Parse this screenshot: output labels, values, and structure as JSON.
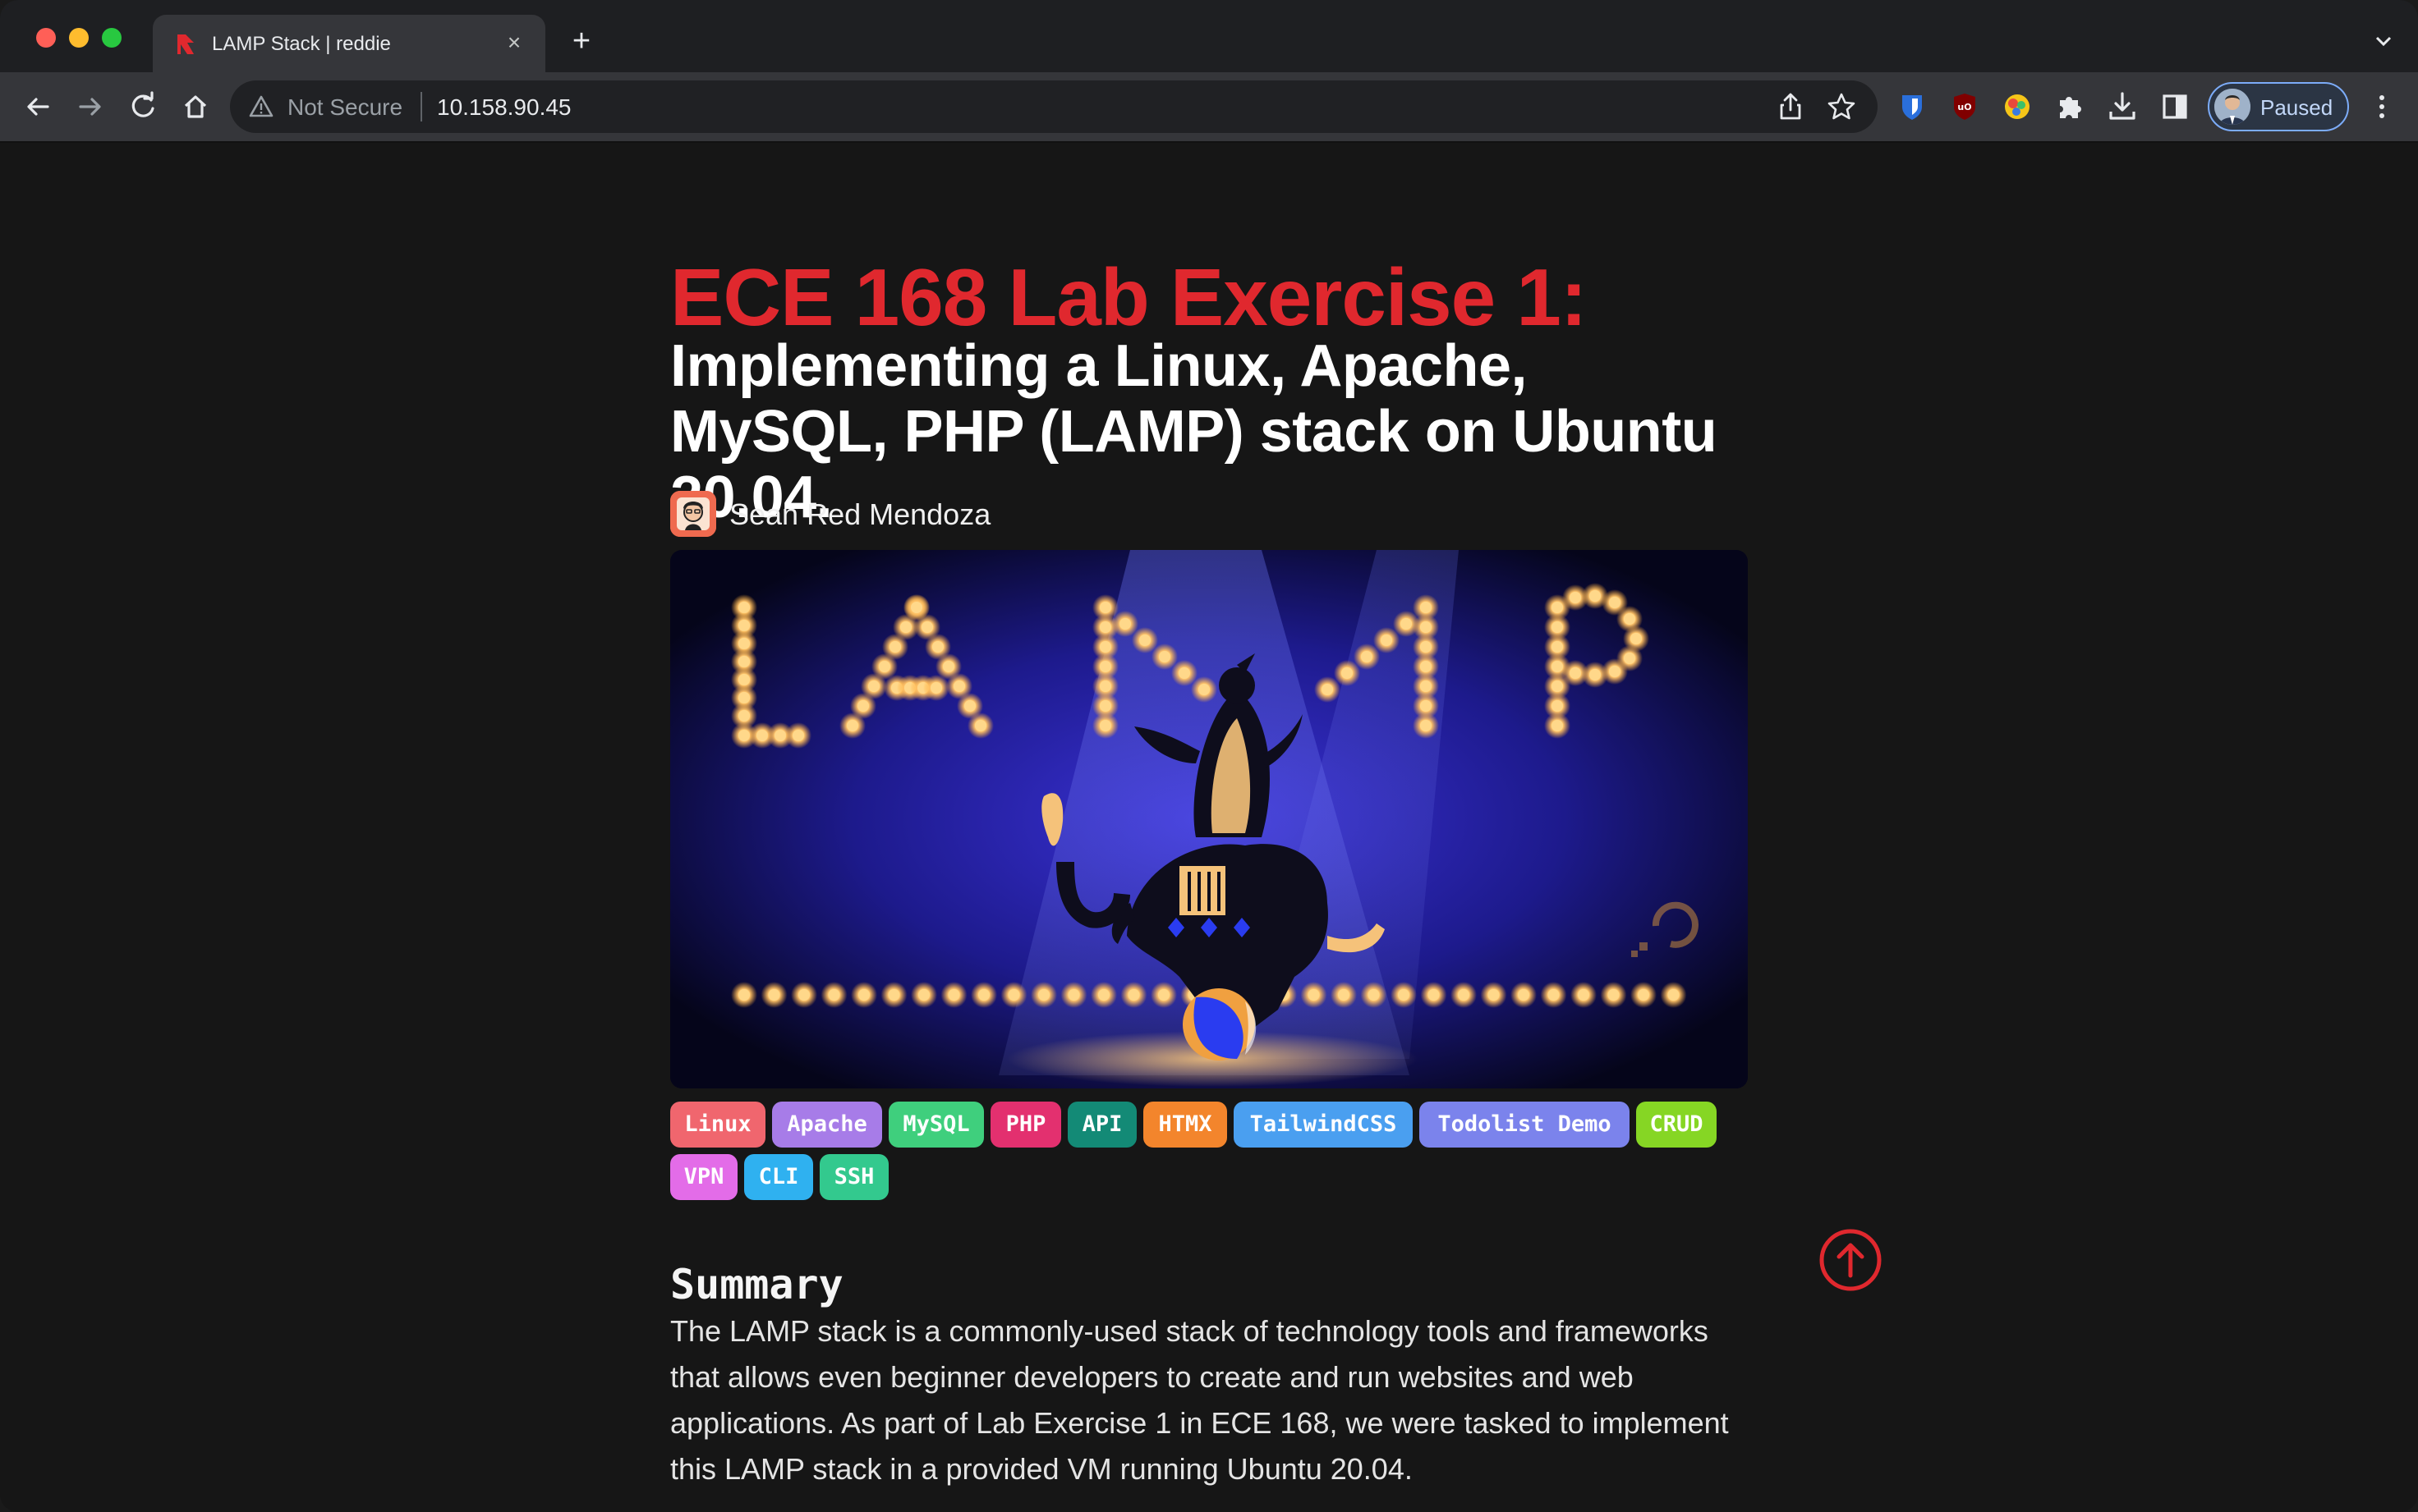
{
  "browser": {
    "tab": {
      "title": "LAMP Stack | reddie",
      "favicon": "reddie-logo-icon"
    },
    "address": {
      "security_label": "Not Secure",
      "url": "10.158.90.45"
    },
    "profile": {
      "label": "Paused"
    },
    "colors": {
      "tabstrip": "#1e1f22",
      "toolbar": "#35363a",
      "omnibox": "#202124"
    }
  },
  "article": {
    "title": "ECE 168 Lab Exercise 1:",
    "subtitle": "Implementing a Linux, Apache, MySQL, PHP (LAMP) stack on Ubuntu 20.04.",
    "author": "Sean Red Mendoza",
    "tags": [
      {
        "label": "Linux",
        "color": "#f0666e"
      },
      {
        "label": "Apache",
        "color": "#a77ce8"
      },
      {
        "label": "MySQL",
        "color": "#3fcf7d"
      },
      {
        "label": "PHP",
        "color": "#e3306f"
      },
      {
        "label": "API",
        "color": "#138a76"
      },
      {
        "label": "HTMX",
        "color": "#f3852c"
      },
      {
        "label": "TailwindCSS",
        "color": "#4a9ff0"
      },
      {
        "label": "Todolist Demo",
        "color": "#7b83ec"
      },
      {
        "label": "CRUD",
        "color": "#86d624"
      },
      {
        "label": "VPN",
        "color": "#e36ce8"
      },
      {
        "label": "CLI",
        "color": "#2fb1f0"
      },
      {
        "label": "SSH",
        "color": "#33c98e"
      }
    ],
    "hero_text": "LAMP",
    "summary_heading": "Summary",
    "summary_text": "The LAMP stack is a commonly-used stack of technology tools and frameworks that allows even beginner developers to create and run websites and web applications. As part of Lab Exercise 1 in ECE 168, we were tasked to implement this LAMP stack in a provided VM running Ubuntu 20.04.",
    "accent_color": "#e0282e"
  }
}
